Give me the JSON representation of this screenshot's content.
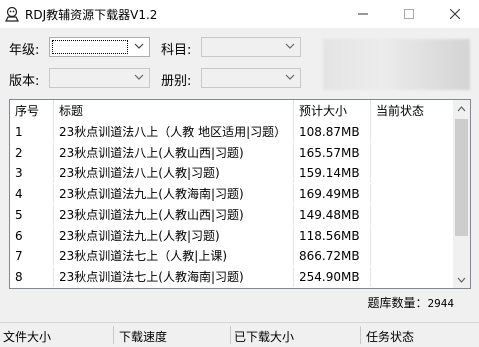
{
  "window": {
    "title": "RDJ教辅资源下载器V1.2"
  },
  "filters": {
    "grade_label": "年级:",
    "subject_label": "科目:",
    "edition_label": "版本:",
    "volume_label": "册别:"
  },
  "table": {
    "headers": [
      "序号",
      "标题",
      "预计大小",
      "当前状态"
    ],
    "rows": [
      [
        "1",
        "23秋点训道法八上（人教 地区适用|习题）",
        "108.87MB",
        ""
      ],
      [
        "2",
        "23秋点训道法八上(人教山西|习题)",
        "165.57MB",
        ""
      ],
      [
        "3",
        "23秋点训道法八上(人教|习题)",
        "159.14MB",
        ""
      ],
      [
        "4",
        "23秋点训道法九上(人教海南|习题)",
        "169.49MB",
        ""
      ],
      [
        "5",
        "23秋点训道法九上(人教山西|习题)",
        "149.48MB",
        ""
      ],
      [
        "6",
        "23秋点训道法九上(人教|习题)",
        "118.56MB",
        ""
      ],
      [
        "7",
        "23秋点训道法七上（人教|上课)",
        "866.72MB",
        ""
      ],
      [
        "8",
        "23秋点训道法七上(人教海南|习题)",
        "254.90MB",
        ""
      ]
    ]
  },
  "summary": {
    "label": "题库数量：",
    "count": "2944"
  },
  "status_bar": {
    "file_size": "文件大小",
    "download_speed": "下载速度",
    "downloaded_size": "已下载大小",
    "task_status": "任务状态"
  }
}
